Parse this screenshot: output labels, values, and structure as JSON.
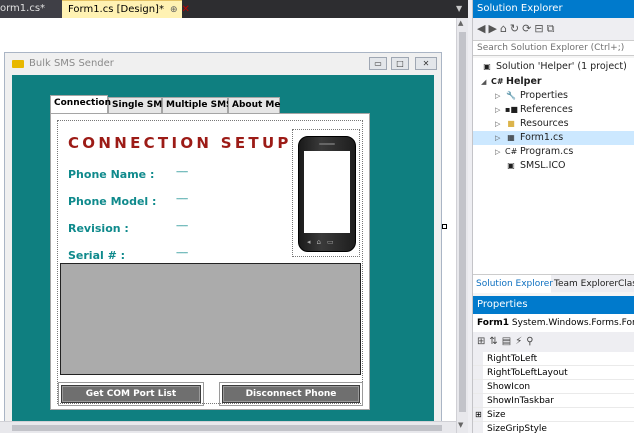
{
  "editor": {
    "tabs": [
      {
        "label": "orm1.cs*"
      },
      {
        "label": "Form1.cs [Design]*",
        "pin": "⊕",
        "close": "✕"
      }
    ],
    "dropdown": "▼"
  },
  "form": {
    "title": "Bulk SMS Sender",
    "window_buttons": {
      "minimize": "▭",
      "maximize": "□",
      "close": "✕"
    },
    "tabs": [
      "Connection",
      "Single SMS",
      "Multiple SMS",
      "About Me"
    ],
    "active_tab": "Connection",
    "setup_title": "CONNECTION SETUP",
    "fields": [
      {
        "label": "Phone Name :",
        "value": "-----"
      },
      {
        "label": "Phone Model :",
        "value": "-----"
      },
      {
        "label": "Revision :",
        "value": "-----"
      },
      {
        "label": "Serial # :",
        "value": "-----"
      }
    ],
    "buttons": {
      "get_com": "Get COM Port List",
      "disconnect": "Disconnect Phone"
    },
    "colors": {
      "client_bg": "#0f7f80",
      "title": "#9c1b16",
      "labels": "#0f8a8c"
    }
  },
  "solution_explorer": {
    "title": "Solution Explorer",
    "search_placeholder": "Search Solution Explorer (Ctrl+;)",
    "tree": [
      {
        "label": "Solution 'Helper' (1 project)",
        "icon": "solution-icon"
      },
      {
        "label": "Helper",
        "icon": "csharp-project-icon"
      },
      {
        "label": "Properties",
        "icon": "wrench-icon"
      },
      {
        "label": "References",
        "icon": "references-icon"
      },
      {
        "label": "Resources",
        "icon": "folder-icon"
      },
      {
        "label": "Form1.cs",
        "icon": "form-icon",
        "selected": true
      },
      {
        "label": "Program.cs",
        "icon": "csharp-file-icon"
      },
      {
        "label": "SMSL.ICO",
        "icon": "icon-file-icon"
      }
    ],
    "bottom_tabs": [
      "Solution Explorer",
      "Team Explorer",
      "Clas"
    ]
  },
  "properties": {
    "title": "Properties",
    "object_name": "Form1",
    "object_type": "System.Windows.Forms.Form",
    "rows": [
      "RightToLeft",
      "RightToLeftLayout",
      "ShowIcon",
      "ShowInTaskbar",
      "Size",
      "SizeGripStyle"
    ]
  }
}
